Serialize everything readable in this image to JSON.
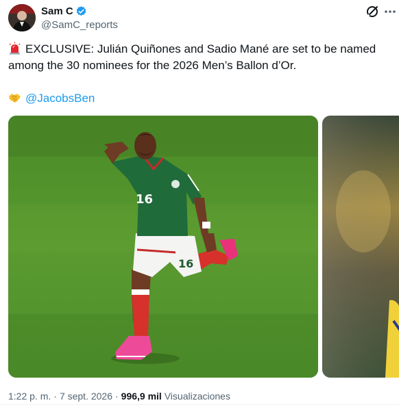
{
  "author": {
    "display_name": "Sam C",
    "handle": "@SamC_reports",
    "verified": true
  },
  "tweet": {
    "line1": "EXCLUSIVE: Julián Quiñones and Sadio Mané are set to be named",
    "line2": "among the 30 nominees for the 2026 Men’s Ballon d’Or.",
    "lead_emoji": "siren-emoji",
    "mention_emoji": "handshake-emoji",
    "mention": "@JacobsBen"
  },
  "media": {
    "main_jersey_number": "16",
    "shorts_number": "16"
  },
  "meta": {
    "time": "1:22 p. m.",
    "date": "7 sept. 2026",
    "views_count": "996,9 mil",
    "views_label": "Visualizaciones",
    "separator": "·"
  },
  "colors": {
    "accent": "#1d9bf0",
    "secondary_text": "#536471",
    "primary_text": "#0f1419"
  }
}
